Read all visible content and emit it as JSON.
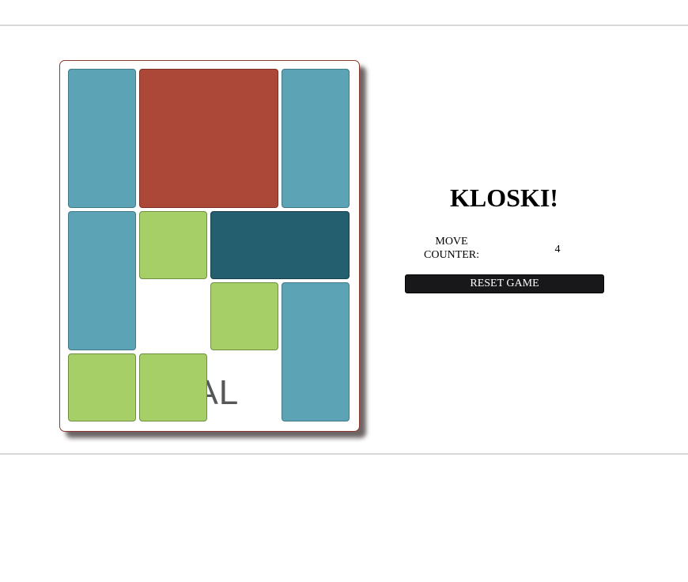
{
  "board": {
    "goal_label": "GOAL",
    "colors": {
      "tall": "#5ca3b6",
      "big": "#ac4838",
      "wide": "#235f6e",
      "small": "#a6cf68"
    },
    "grid": {
      "columns": 4,
      "rows": 5
    },
    "blocks": [
      {
        "id": "tall-1",
        "kind": "tall",
        "col": 0,
        "row": 0,
        "w": 1,
        "h": 2
      },
      {
        "id": "big",
        "kind": "big",
        "col": 1,
        "row": 0,
        "w": 2,
        "h": 2
      },
      {
        "id": "tall-2",
        "kind": "tall",
        "col": 3,
        "row": 0,
        "w": 1,
        "h": 2
      },
      {
        "id": "tall-3",
        "kind": "tall",
        "col": 0,
        "row": 2,
        "w": 1,
        "h": 2
      },
      {
        "id": "small-1",
        "kind": "small",
        "col": 1,
        "row": 2,
        "w": 1,
        "h": 1
      },
      {
        "id": "wide",
        "kind": "wide",
        "col": 2,
        "row": 2,
        "w": 2,
        "h": 1
      },
      {
        "id": "small-2",
        "kind": "small",
        "col": 2,
        "row": 3,
        "w": 1,
        "h": 1
      },
      {
        "id": "tall-4",
        "kind": "tall",
        "col": 3,
        "row": 3,
        "w": 1,
        "h": 2
      },
      {
        "id": "small-3",
        "kind": "small",
        "col": 0,
        "row": 4,
        "w": 1,
        "h": 1
      },
      {
        "id": "small-4",
        "kind": "small",
        "col": 1,
        "row": 4,
        "w": 1,
        "h": 1
      }
    ]
  },
  "panel": {
    "title": "KLOSKI!",
    "counter_label": "MOVE COUNTER:",
    "counter_value": "4",
    "reset_label": "RESET GAME"
  }
}
